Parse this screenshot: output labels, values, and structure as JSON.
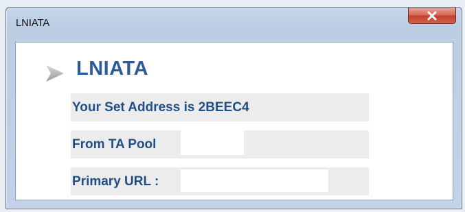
{
  "window": {
    "title": "LNIATA"
  },
  "content": {
    "heading": "LNIATA",
    "set_address_label": "Your Set Address is 2BEEC4",
    "ta_pool_label": "From TA Pool",
    "ta_pool_value": "",
    "primary_url_label": "Primary URL :",
    "primary_url_value": ""
  },
  "colors": {
    "heading": "#2c5b9c",
    "label": "#1f4f86",
    "close_button": "#c0402b"
  },
  "icons": {
    "close": "close-icon",
    "header": "arrow-right-icon"
  }
}
